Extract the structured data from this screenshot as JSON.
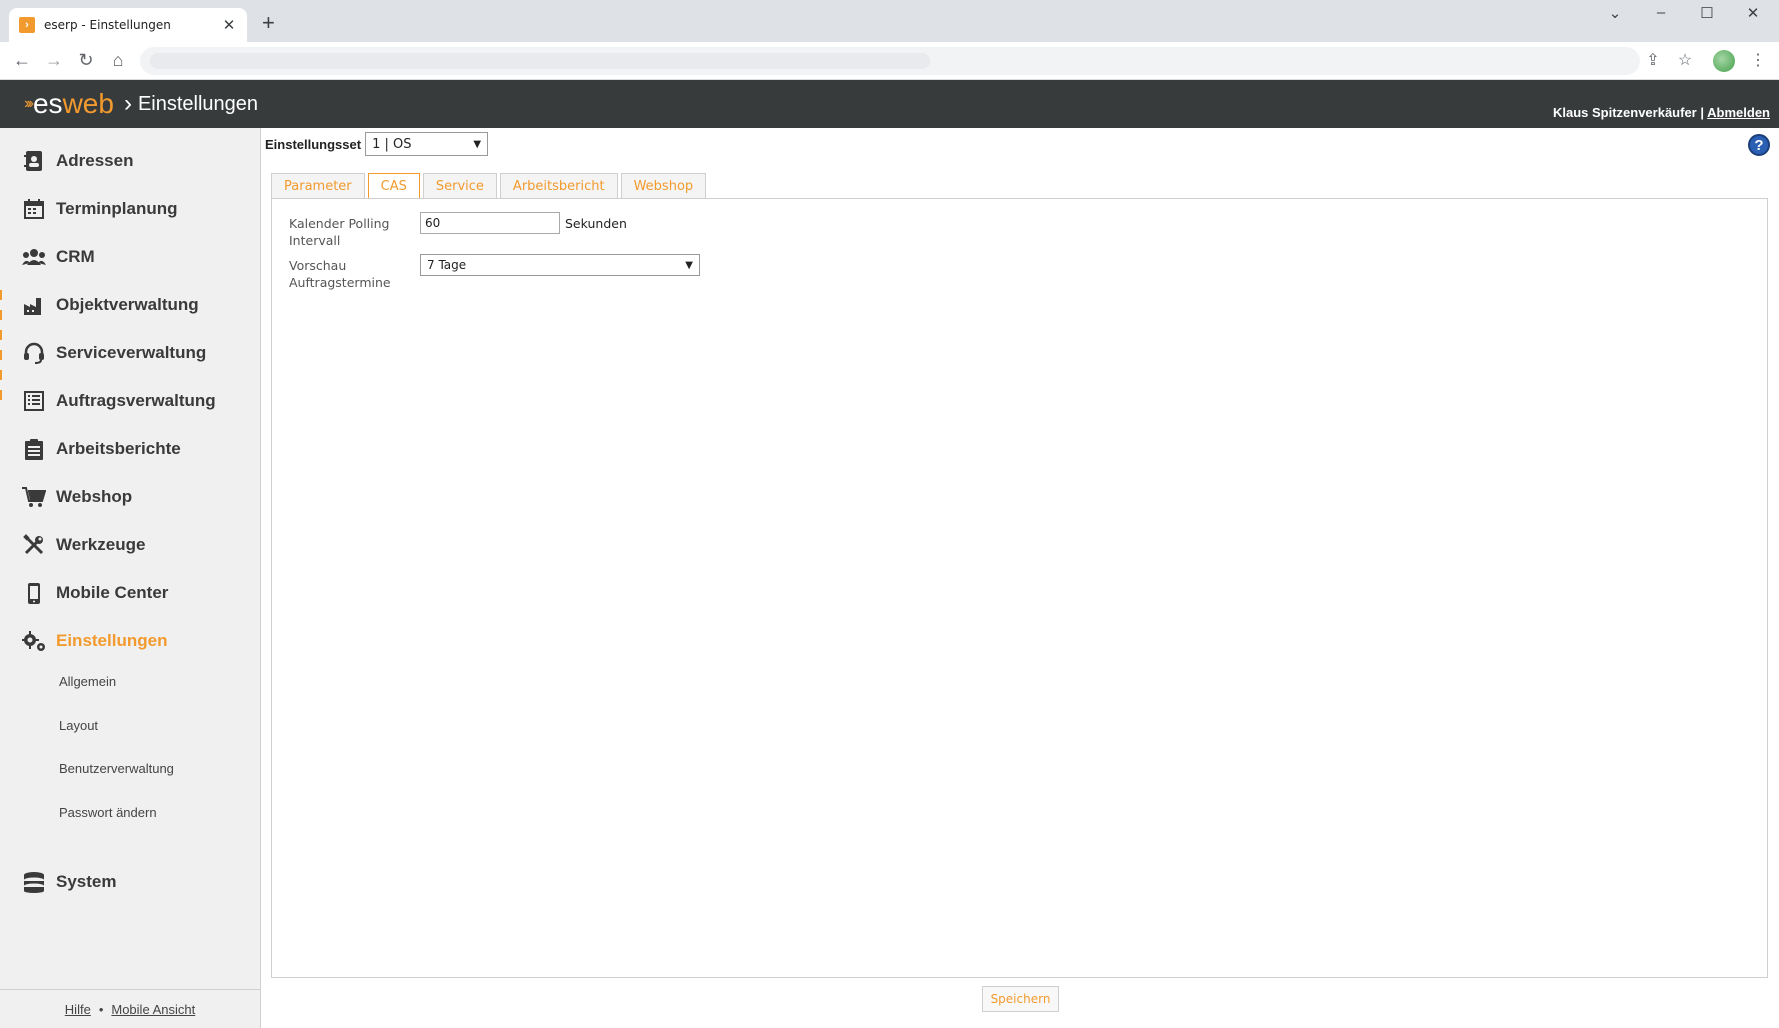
{
  "browser": {
    "tab_title": "eserp - Einstellungen",
    "new_tab": "+",
    "close_tab": "✕"
  },
  "header": {
    "logo_es": "es",
    "logo_web": "web",
    "breadcrumb_sep": "›",
    "page_title": "Einstellungen",
    "user_name": "Klaus Spitzenverkäufer",
    "separator": "|",
    "logout": "Abmelden"
  },
  "sidebar": {
    "items": [
      {
        "label": "Adressen",
        "icon": "address-book-icon"
      },
      {
        "label": "Terminplanung",
        "icon": "calendar-icon"
      },
      {
        "label": "CRM",
        "icon": "users-icon"
      },
      {
        "label": "Objektverwaltung",
        "icon": "factory-icon"
      },
      {
        "label": "Serviceverwaltung",
        "icon": "headset-icon"
      },
      {
        "label": "Auftragsverwaltung",
        "icon": "list-icon"
      },
      {
        "label": "Arbeitsberichte",
        "icon": "clipboard-icon"
      },
      {
        "label": "Webshop",
        "icon": "cart-icon"
      },
      {
        "label": "Werkzeuge",
        "icon": "tools-icon"
      },
      {
        "label": "Mobile Center",
        "icon": "mobile-icon"
      },
      {
        "label": "Einstellungen",
        "icon": "gears-icon"
      },
      {
        "label": "System",
        "icon": "database-icon"
      }
    ],
    "subitems": [
      "Allgemein",
      "Layout",
      "Benutzerverwaltung",
      "Passwort ändern"
    ],
    "footer": {
      "help": "Hilfe",
      "dot": "•",
      "mobile": "Mobile Ansicht"
    }
  },
  "settings": {
    "set_label": "Einstellungsset",
    "set_value": "1 | OS"
  },
  "tabs": [
    "Parameter",
    "CAS",
    "Service",
    "Arbeitsbericht",
    "Webshop"
  ],
  "active_tab": "CAS",
  "form": {
    "polling_label_1": "Kalender Polling",
    "polling_label_2": "Intervall",
    "polling_value": "60",
    "polling_unit": "Sekunden",
    "preview_label_1": "Vorschau",
    "preview_label_2": "Auftragstermine",
    "preview_value": "7 Tage"
  },
  "save_button": "Speichern",
  "help_button": "?",
  "colors": {
    "accent": "#f29a2e",
    "header": "#373b3c",
    "sidebar": "#f0f0f0"
  }
}
